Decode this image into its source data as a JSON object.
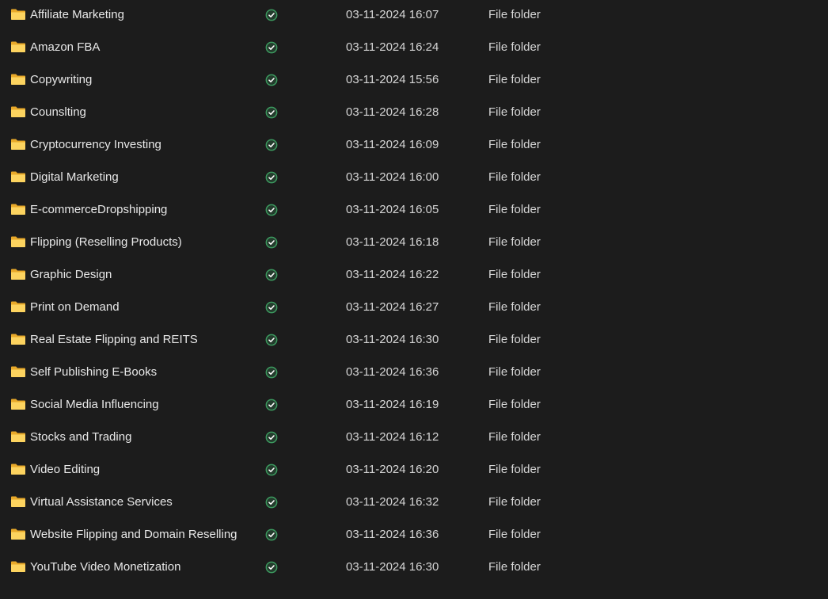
{
  "colors": {
    "background": "#1c1c1c",
    "text": "#e8e8e8",
    "folder_back": "#e8a92a",
    "folder_front": "#fcd35f",
    "status_ring": "#3c9a5f",
    "status_check": "#ffffff"
  },
  "icons": {
    "folder": "folder-icon",
    "status": "sync-status-check-icon"
  },
  "files": [
    {
      "name": "Affiliate Marketing",
      "modified": "03-11-2024 16:07",
      "type": "File folder"
    },
    {
      "name": "Amazon FBA",
      "modified": "03-11-2024 16:24",
      "type": "File folder"
    },
    {
      "name": "Copywriting",
      "modified": "03-11-2024 15:56",
      "type": "File folder"
    },
    {
      "name": "Counslting",
      "modified": "03-11-2024 16:28",
      "type": "File folder"
    },
    {
      "name": "Cryptocurrency Investing",
      "modified": "03-11-2024 16:09",
      "type": "File folder"
    },
    {
      "name": "Digital Marketing",
      "modified": "03-11-2024 16:00",
      "type": "File folder"
    },
    {
      "name": "E-commerceDropshipping",
      "modified": "03-11-2024 16:05",
      "type": "File folder"
    },
    {
      "name": "Flipping (Reselling Products)",
      "modified": "03-11-2024 16:18",
      "type": "File folder"
    },
    {
      "name": "Graphic Design",
      "modified": "03-11-2024 16:22",
      "type": "File folder"
    },
    {
      "name": "Print on Demand",
      "modified": "03-11-2024 16:27",
      "type": "File folder"
    },
    {
      "name": "Real Estate Flipping and REITS",
      "modified": "03-11-2024 16:30",
      "type": "File folder"
    },
    {
      "name": "Self Publishing E-Books",
      "modified": "03-11-2024 16:36",
      "type": "File folder"
    },
    {
      "name": "Social Media Influencing",
      "modified": "03-11-2024 16:19",
      "type": "File folder"
    },
    {
      "name": "Stocks and Trading",
      "modified": "03-11-2024 16:12",
      "type": "File folder"
    },
    {
      "name": "Video Editing",
      "modified": "03-11-2024 16:20",
      "type": "File folder"
    },
    {
      "name": "Virtual Assistance Services",
      "modified": "03-11-2024 16:32",
      "type": "File folder"
    },
    {
      "name": "Website Flipping and Domain Reselling",
      "modified": "03-11-2024 16:36",
      "type": "File folder"
    },
    {
      "name": "YouTube Video Monetization",
      "modified": "03-11-2024 16:30",
      "type": "File folder"
    }
  ]
}
